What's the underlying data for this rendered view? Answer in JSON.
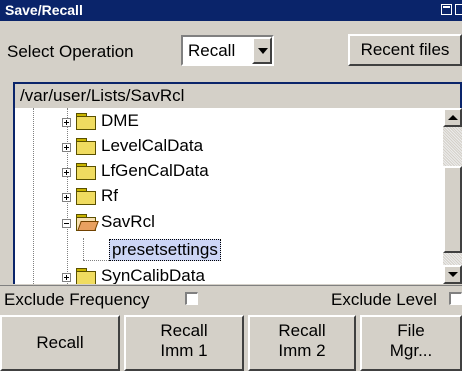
{
  "window": {
    "title": "Save/Recall"
  },
  "operation": {
    "label": "Select Operation",
    "value": "Recall",
    "recent_files_label": "Recent files"
  },
  "path": "/var/user/Lists/SavRcl",
  "tree": {
    "items": [
      {
        "label": "DME",
        "expanded": false
      },
      {
        "label": "LevelCalData",
        "expanded": false
      },
      {
        "label": "LfGenCalData",
        "expanded": false
      },
      {
        "label": "Rf",
        "expanded": false
      },
      {
        "label": "SavRcl",
        "expanded": true
      },
      {
        "label": "presetsettings",
        "selected": true
      },
      {
        "label": "SynCalibData",
        "expanded": false
      }
    ]
  },
  "options": {
    "exclude_frequency_label": "Exclude Frequency",
    "exclude_level_label": "Exclude Level",
    "exclude_frequency": false,
    "exclude_level": false
  },
  "buttons": {
    "recall": "Recall",
    "recall_imm1": {
      "line1": "Recall",
      "line2": "Imm 1"
    },
    "recall_imm2": {
      "line1": "Recall",
      "line2": "Imm 2"
    },
    "file_mgr": {
      "line1": "File",
      "line2": "Mgr..."
    }
  }
}
